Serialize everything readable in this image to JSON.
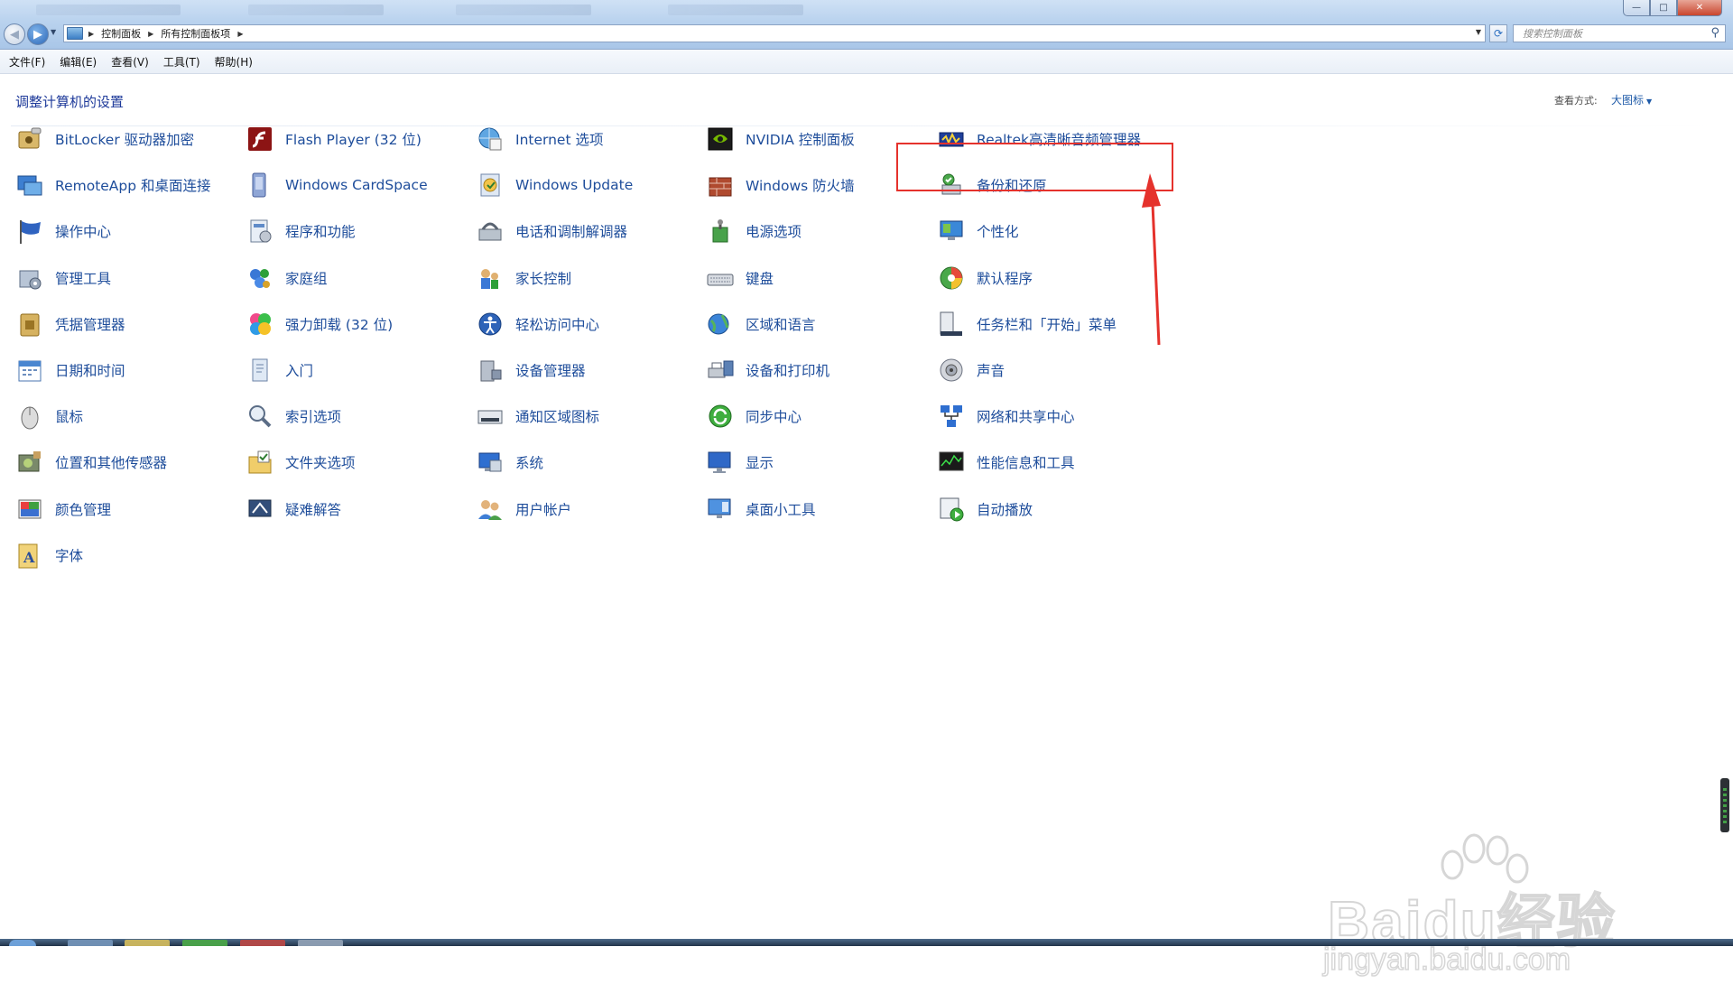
{
  "window": {
    "breadcrumb": [
      "控制面板",
      "所有控制面板项"
    ],
    "search_placeholder": "搜索控制面板",
    "controls": {
      "minimize": "—",
      "maximize": "□",
      "close": "✕"
    }
  },
  "menubar": [
    "文件(F)",
    "编辑(E)",
    "查看(V)",
    "工具(T)",
    "帮助(H)"
  ],
  "header": {
    "title": "调整计算机的设置",
    "view_label": "查看方式:",
    "view_value": "大图标"
  },
  "columns": [
    [
      {
        "label": "BitLocker 驱动器加密",
        "icon": "bitlocker-icon"
      },
      {
        "label": "RemoteApp 和桌面连接",
        "icon": "remoteapp-icon"
      },
      {
        "label": "操作中心",
        "icon": "action-center-flag-icon"
      },
      {
        "label": "管理工具",
        "icon": "admin-tools-icon"
      },
      {
        "label": "凭据管理器",
        "icon": "credential-manager-icon"
      },
      {
        "label": "日期和时间",
        "icon": "date-time-icon"
      },
      {
        "label": "鼠标",
        "icon": "mouse-icon"
      },
      {
        "label": "位置和其他传感器",
        "icon": "location-sensors-icon"
      },
      {
        "label": "颜色管理",
        "icon": "color-management-icon"
      },
      {
        "label": "字体",
        "icon": "fonts-icon"
      }
    ],
    [
      {
        "label": "Flash Player (32 位)",
        "icon": "flash-player-icon"
      },
      {
        "label": "Windows CardSpace",
        "icon": "cardspace-icon"
      },
      {
        "label": "程序和功能",
        "icon": "programs-features-icon"
      },
      {
        "label": "家庭组",
        "icon": "homegroup-icon"
      },
      {
        "label": "强力卸载 (32 位)",
        "icon": "uninstaller-icon"
      },
      {
        "label": "入门",
        "icon": "getting-started-icon"
      },
      {
        "label": "索引选项",
        "icon": "indexing-options-icon"
      },
      {
        "label": "文件夹选项",
        "icon": "folder-options-icon"
      },
      {
        "label": "疑难解答",
        "icon": "troubleshooting-icon"
      }
    ],
    [
      {
        "label": "Internet 选项",
        "icon": "internet-options-icon"
      },
      {
        "label": "Windows Update",
        "icon": "windows-update-icon"
      },
      {
        "label": "电话和调制解调器",
        "icon": "phone-modem-icon"
      },
      {
        "label": "家长控制",
        "icon": "parental-controls-icon"
      },
      {
        "label": "轻松访问中心",
        "icon": "ease-of-access-icon"
      },
      {
        "label": "设备管理器",
        "icon": "device-manager-icon"
      },
      {
        "label": "通知区域图标",
        "icon": "notification-area-icon"
      },
      {
        "label": "系统",
        "icon": "system-icon"
      },
      {
        "label": "用户帐户",
        "icon": "user-accounts-icon"
      }
    ],
    [
      {
        "label": "NVIDIA 控制面板",
        "icon": "nvidia-icon"
      },
      {
        "label": "Windows 防火墙",
        "icon": "firewall-icon"
      },
      {
        "label": "电源选项",
        "icon": "power-options-icon"
      },
      {
        "label": "键盘",
        "icon": "keyboard-icon"
      },
      {
        "label": "区域和语言",
        "icon": "region-language-icon"
      },
      {
        "label": "设备和打印机",
        "icon": "devices-printers-icon"
      },
      {
        "label": "同步中心",
        "icon": "sync-center-icon"
      },
      {
        "label": "显示",
        "icon": "display-icon"
      },
      {
        "label": "桌面小工具",
        "icon": "gadgets-icon"
      }
    ],
    [
      {
        "label": "Realtek高清晰音频管理器",
        "icon": "realtek-audio-icon"
      },
      {
        "label": "备份和还原",
        "icon": "backup-restore-icon"
      },
      {
        "label": "个性化",
        "icon": "personalization-icon"
      },
      {
        "label": "默认程序",
        "icon": "default-programs-icon"
      },
      {
        "label": "任务栏和「开始」菜单",
        "icon": "taskbar-start-icon"
      },
      {
        "label": "声音",
        "icon": "sound-icon"
      },
      {
        "label": "网络和共享中心",
        "icon": "network-sharing-icon"
      },
      {
        "label": "性能信息和工具",
        "icon": "performance-icon"
      },
      {
        "label": "自动播放",
        "icon": "autoplay-icon"
      }
    ]
  ],
  "annotation": {
    "highlighted_item": "Realtek高清晰音频管理器",
    "color": "#e5322c"
  },
  "watermark": {
    "brand": "Baidu经验",
    "url": "jingyan.baidu.com"
  },
  "colors": {
    "link": "#1e4d9b",
    "title": "#1e3a9a",
    "accent": "#e5322c"
  }
}
